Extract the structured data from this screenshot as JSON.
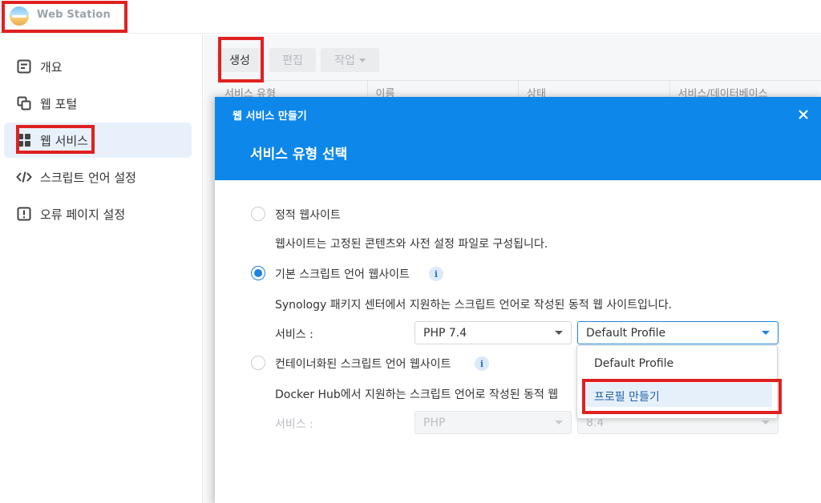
{
  "app": {
    "title": "Web Station"
  },
  "sidebar": {
    "items": [
      {
        "label": "개요",
        "icon": "overview-icon"
      },
      {
        "label": "웹 포털",
        "icon": "web-portal-icon"
      },
      {
        "label": "웹 서비스",
        "icon": "web-service-icon",
        "active": true
      },
      {
        "label": "스크립트 언어 설정",
        "icon": "code-icon"
      },
      {
        "label": "오류 페이지 설정",
        "icon": "error-page-icon"
      }
    ]
  },
  "toolbar": {
    "create": "생성",
    "edit": "편집",
    "action": "작업"
  },
  "grid": {
    "columns": [
      "서비스 유형",
      "이름",
      "상태",
      "서비스/데이터베이스"
    ]
  },
  "dialog": {
    "window_title": "웹 서비스 만들기",
    "step_title": "서비스 유형 선택",
    "options": [
      {
        "label": "정적 웹사이트",
        "desc": "웹사이트는 고정된 콘텐츠와 사전 설정 파일로 구성됩니다.",
        "checked": false
      },
      {
        "label": "기본 스크립트 언어 웹사이트",
        "desc": "Synology 패키지 센터에서 지원하는 스크립트 언어로 작성된 동적 웹 사이트입니다.",
        "checked": true
      },
      {
        "label": "컨테이너화된 스크립트 언어 웹사이트",
        "desc": "Docker Hub에서 지원하는 스크립트 언어로 작성된 동적 웹",
        "checked": false
      }
    ],
    "service_label": "서비스 :",
    "basic": {
      "php": "PHP 7.4",
      "profile": "Default Profile"
    },
    "container": {
      "php": "PHP",
      "version": "8.4"
    },
    "dropdown": {
      "items": [
        "Default Profile",
        "프로필 만들기"
      ]
    }
  },
  "colors": {
    "accent": "#0d87e9",
    "highlight": "#e02020"
  }
}
